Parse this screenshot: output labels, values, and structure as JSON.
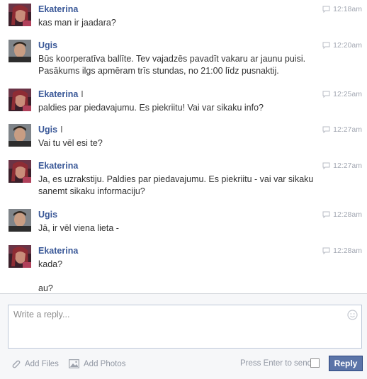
{
  "messages": [
    {
      "sender": "Ekaterina",
      "mark": "",
      "time": "12:18am",
      "lines": [
        "kas man ir jaadara?"
      ]
    },
    {
      "sender": "Ugis",
      "mark": "",
      "time": "12:20am",
      "lines": [
        "Būs koorperatīva ballīte. Tev vajadzēs pavadīt vakaru ar jaunu puisi.",
        "Pasākums ilgs apmēram trīs stundas, no 21:00 līdz pusnaktij."
      ]
    },
    {
      "sender": "Ekaterina",
      "mark": "I",
      "time": "12:25am",
      "lines": [
        "paldies par piedavajumu. Es piekriitu! Vai var sikaku info?"
      ]
    },
    {
      "sender": "Ugis",
      "mark": "I",
      "time": "12:27am",
      "lines": [
        "Vai tu vēl esi te?"
      ]
    },
    {
      "sender": "Ekaterina",
      "mark": "",
      "time": "12:27am",
      "lines": [
        "Ja, es uzrakstiju. Paldies par piedavajumu. Es piekriitu - vai var sikaku",
        "sanemt sikaku informaciju?"
      ]
    },
    {
      "sender": "Ugis",
      "mark": "",
      "time": "12:28am",
      "lines": [
        "Jā, ir vēl viena lieta -"
      ]
    },
    {
      "sender": "Ekaterina",
      "mark": "",
      "time": "12:28am",
      "lines": [
        "kada?",
        "",
        "au?"
      ]
    }
  ],
  "composer": {
    "placeholder": "Write a reply...",
    "add_files": "Add Files",
    "add_photos": "Add Photos",
    "enter_to_send": "Press Enter to send",
    "reply_label": "Reply"
  }
}
